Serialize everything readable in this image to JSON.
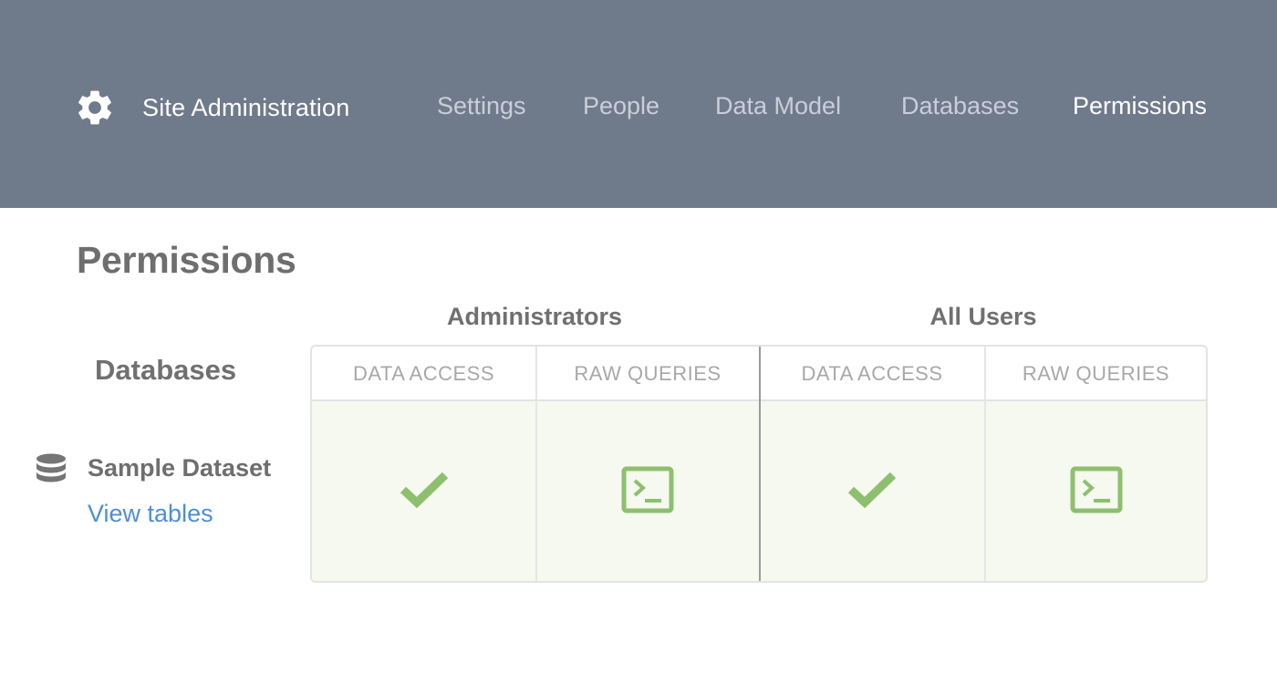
{
  "header": {
    "brand_title": "Site Administration",
    "icon": "gear-icon",
    "nav": [
      {
        "label": "Settings",
        "active": false
      },
      {
        "label": "People",
        "active": false
      },
      {
        "label": "Data Model",
        "active": false
      },
      {
        "label": "Databases",
        "active": false
      },
      {
        "label": "Permissions",
        "active": true
      }
    ]
  },
  "page": {
    "title": "Permissions",
    "databases_label": "Databases"
  },
  "groups": [
    {
      "name": "Administrators",
      "columns": [
        {
          "label": "DATA ACCESS",
          "icon": "checkmark-icon"
        },
        {
          "label": "RAW QUERIES",
          "icon": "terminal-icon"
        }
      ]
    },
    {
      "name": "All Users",
      "columns": [
        {
          "label": "DATA ACCESS",
          "icon": "checkmark-icon"
        },
        {
          "label": "RAW QUERIES",
          "icon": "terminal-icon"
        }
      ]
    }
  ],
  "database": {
    "name": "Sample Dataset",
    "link": "View tables",
    "icon": "database-icon"
  },
  "colors": {
    "header_bg": "#6f7a8b",
    "accent_green": "#8ebf6f",
    "link_blue": "#4c8fd6",
    "cell_bg": "#f5f9f0"
  }
}
